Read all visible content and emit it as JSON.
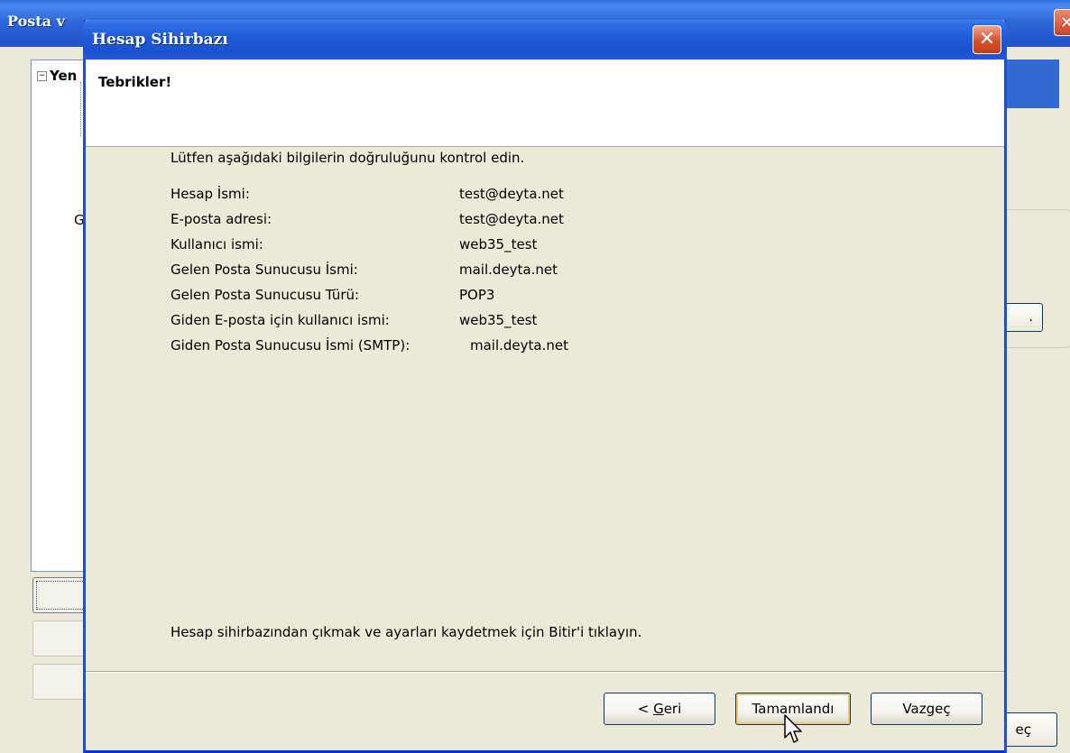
{
  "background": {
    "title": "Posta v",
    "tree_label": "Yen",
    "side_label": "Gide",
    "dots_button": ".",
    "cancel_partial": "eç"
  },
  "dialog": {
    "title": "Hesap Sihirbazı",
    "header": "Tebrikler!",
    "intro": "Lütfen aşağıdaki bilgilerin doğruluğunu kontrol edin.",
    "rows": [
      {
        "label": "Hesap İsmi:",
        "value": "test@deyta.net"
      },
      {
        "label": "E-posta adresi:",
        "value": "test@deyta.net"
      },
      {
        "label": "Kullanıcı ismi:",
        "value": "web35_test"
      },
      {
        "label": "Gelen Posta Sunucusu İsmi:",
        "value": "mail.deyta.net"
      },
      {
        "label": "Gelen Posta Sunucusu Türü:",
        "value": "POP3"
      },
      {
        "label": "Giden E-posta için kullanıcı ismi:",
        "value": "web35_test"
      },
      {
        "label": "Giden Posta Sunucusu İsmi (SMTP):",
        "value": "mail.deyta.net"
      }
    ],
    "outro": "Hesap sihirbazından çıkmak ve ayarları kaydetmek için Bitir'i tıklayın.",
    "buttons": {
      "back_prefix": "< ",
      "back_mnemonic": "G",
      "back_rest": "eri",
      "finish": "Tamamlandı",
      "cancel": "Vazgeç"
    }
  }
}
